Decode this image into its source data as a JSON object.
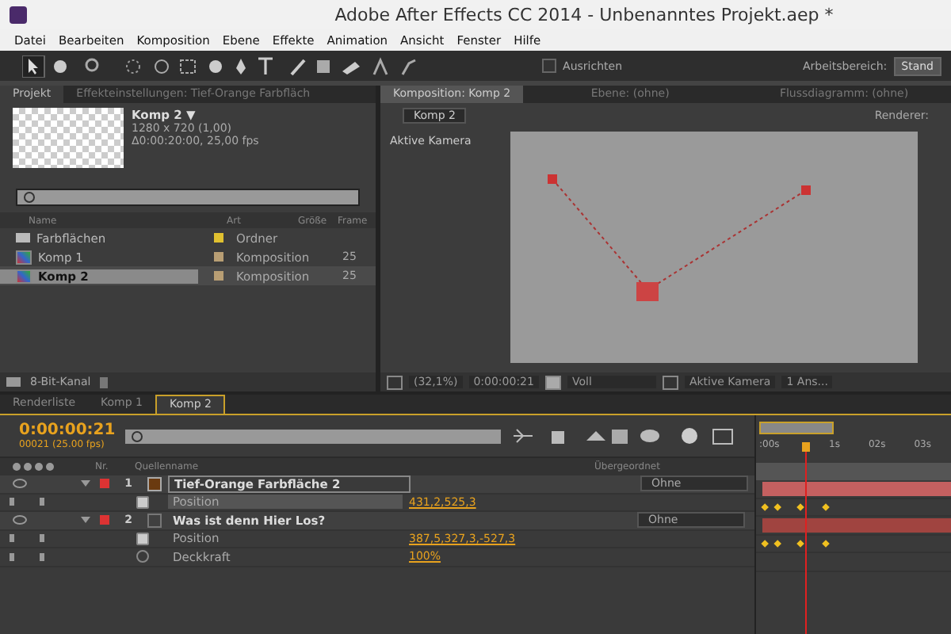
{
  "window": {
    "title": "Adobe After Effects CC 2014 - Unbenanntes Projekt.aep *"
  },
  "menu": [
    "Datei",
    "Bearbeiten",
    "Komposition",
    "Ebene",
    "Effekte",
    "Animation",
    "Ansicht",
    "Fenster",
    "Hilfe"
  ],
  "toolbar": {
    "snap": {
      "label": "Ausrichten",
      "checked": false
    },
    "workspace_label": "Arbeitsbereich:",
    "workspace_value": "Stand"
  },
  "project_panel": {
    "tabs": [
      {
        "label": "Projekt",
        "selected": true
      },
      {
        "label": "Effekteinstellungen: Tief-Orange Farbfläch",
        "selected": false
      }
    ],
    "info": {
      "name": "Komp 2 ▼",
      "size": "1280 x 720 (1,00)",
      "duration": "Δ0:00:20:00, 25,00 fps"
    },
    "columns": [
      "Name",
      "Art",
      "Größe",
      "Frame"
    ],
    "items": [
      {
        "name": "Farbflächen",
        "kind": "folder",
        "type": "Ordner",
        "color": "#e0c030",
        "selected": false
      },
      {
        "name": "Komp 1",
        "kind": "comp",
        "type": "Komposition",
        "color": "#b89e74",
        "frame": "25",
        "selected": false
      },
      {
        "name": "Komp 2",
        "kind": "comp",
        "type": "Komposition",
        "color": "#b89e74",
        "frame": "25",
        "selected": true
      }
    ],
    "footer": "8-Bit-Kanal"
  },
  "comp_panel": {
    "tabs": [
      {
        "label": "Komposition: Komp 2",
        "selected": true
      },
      {
        "label": "Ebene: (ohne)",
        "selected": false
      },
      {
        "label": "Flussdiagramm: (ohne)",
        "selected": false
      }
    ],
    "breadcrumb": "Komp 2",
    "renderer": "Renderer:",
    "camera_label": "Aktive Kamera",
    "viewer_bar": {
      "zoom": "(32,1%)",
      "time": "0:00:00:21",
      "resolution": "Voll",
      "camera": "Aktive Kamera",
      "views": "1 Ans..."
    }
  },
  "timeline": {
    "tabs": [
      {
        "label": "Renderliste",
        "selected": false
      },
      {
        "label": "Komp 1",
        "selected": false
      },
      {
        "label": "Komp 2",
        "selected": true
      }
    ],
    "time": "0:00:00:21",
    "frames": "00021 (25.00 fps)",
    "columns": {
      "nr": "Nr.",
      "source": "Quellenname",
      "parent": "Übergeordnet"
    },
    "ruler": [
      ":00s",
      "1s",
      "02s",
      "03s"
    ],
    "layers": [
      {
        "nr": "1",
        "name": "Tief-Orange Farbfläche 2",
        "kind": "solid",
        "selected": true,
        "parent": "Ohne",
        "properties": [
          {
            "name": "Position",
            "value": "431,2,525,3",
            "animated": true,
            "selected": true
          }
        ]
      },
      {
        "nr": "2",
        "name": "Was ist denn Hier Los?",
        "kind": "text",
        "selected": false,
        "parent": "Ohne",
        "properties": [
          {
            "name": "Position",
            "value": "387,5,327,3,-527,3",
            "animated": true,
            "selected": false
          },
          {
            "name": "Deckkraft",
            "value": "100%",
            "animated": false,
            "selected": false
          }
        ]
      }
    ]
  }
}
